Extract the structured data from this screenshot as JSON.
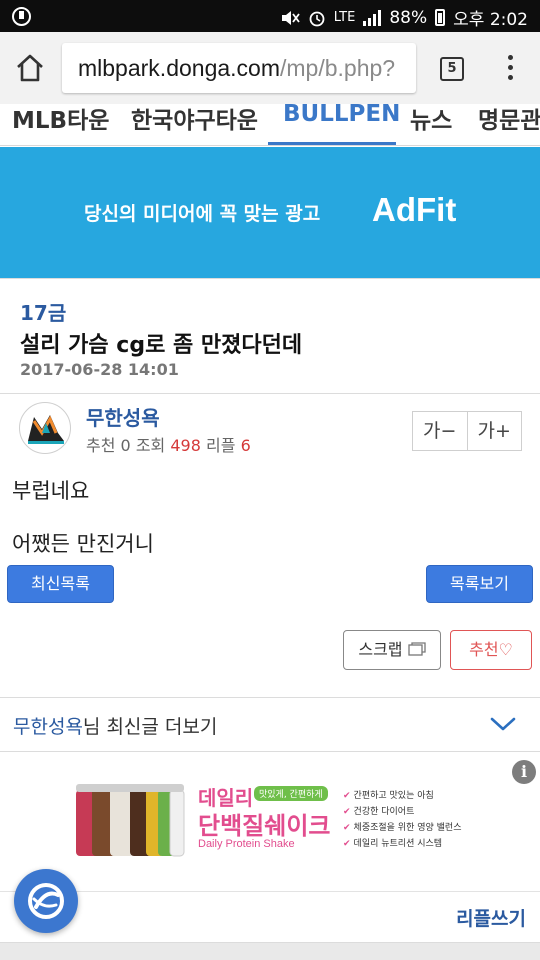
{
  "status_bar": {
    "battery": "88%",
    "time": "오후 2:02",
    "network": "LTE"
  },
  "browser": {
    "url_host": "mlbpark.donga.com",
    "url_path": "/mp/b.php?",
    "tab_count": "5"
  },
  "nav": {
    "items": [
      {
        "label": "MLB타운",
        "active": false
      },
      {
        "label": "한국야구타운",
        "active": false
      },
      {
        "label": "BULLPEN",
        "active": true
      },
      {
        "label": "뉴스",
        "active": false
      },
      {
        "label": "명문관",
        "active": false
      }
    ]
  },
  "ad_top": {
    "message": "당신의 미디어에 꼭 맞는 광고",
    "brand": "AdFit"
  },
  "post": {
    "category": "17금",
    "title": "설리 가슴 cg로 좀 만졌다던데",
    "date": "2017-06-28 14:01"
  },
  "author": {
    "name": "무한성욕",
    "recommend_label": "추천",
    "recommend_count": "0",
    "views_label": "조회",
    "views_count": "498",
    "replies_label": "리플",
    "replies_count": "6"
  },
  "font_controls": {
    "decrease": "가−",
    "increase": "가+"
  },
  "body": {
    "line1": "부럽네요",
    "line2": "어쨌든 만진거니"
  },
  "buttons": {
    "recent_list": "최신목록",
    "view_list": "목록보기",
    "scrap": "스크랩",
    "recommend": "추천♡"
  },
  "author_more": {
    "name": "무한성욕",
    "suffix": "님 최신글 더보기"
  },
  "ad_bottom": {
    "slogan": "맛있게, 간편하게",
    "line1": "데일리",
    "line2": "단백질쉐이크",
    "english": "Daily Protein Shake",
    "checks": [
      "간편하고 맛있는 아침",
      "건강한 다이어트",
      "체중조절을 위한 영양 밸런스",
      "데일리 뉴트리션 시스템"
    ]
  },
  "reply": {
    "write_label": "리플쓰기"
  },
  "colors": {
    "accent": "#3b78c8",
    "button_blue": "#3d7be0",
    "adfit_bg": "#27a7df",
    "red": "#d53a3a"
  }
}
